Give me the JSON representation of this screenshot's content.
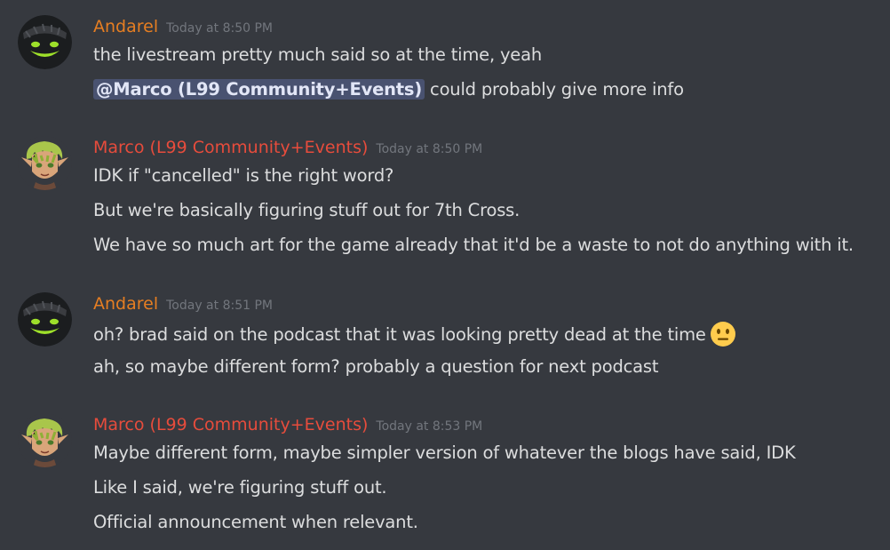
{
  "colors": {
    "andarel": "#e67e22",
    "marco": "#e74c3c",
    "background": "#36393f",
    "text": "#dcddde",
    "timestamp": "#72767d",
    "mention_bg": "#4a4f72"
  },
  "messages": [
    {
      "author": "Andarel",
      "timestamp": "Today at 8:50 PM",
      "avatar_icon": "smiling-mask-avatar-icon",
      "lines": [
        "the livestream pretty much said so at the time, yeah"
      ],
      "mention_line": {
        "mention": "@Marco (L99 Community+Events)",
        "text": " could probably give more info"
      }
    },
    {
      "author": "Marco (L99 Community+Events)",
      "timestamp": "Today at 8:50 PM",
      "avatar_icon": "elf-character-avatar-icon",
      "lines": [
        "IDK if \"cancelled\" is the right word?",
        "But we're basically figuring stuff out for 7th Cross.",
        "We have so much art for the game already that it'd be a waste to not do anything with it."
      ]
    },
    {
      "author": "Andarel",
      "timestamp": "Today at 8:51 PM",
      "avatar_icon": "smiling-mask-avatar-icon",
      "lines": [
        "oh? brad said on the podcast that it was looking pretty dead at the time",
        "ah, so maybe different form? probably a question for next podcast"
      ],
      "emoji": "neutral-face-emoji-icon"
    },
    {
      "author": "Marco (L99 Community+Events)",
      "timestamp": "Today at 8:53 PM",
      "avatar_icon": "elf-character-avatar-icon",
      "lines": [
        "Maybe different form, maybe simpler version of whatever the blogs have said, IDK",
        "Like I said, we're figuring stuff out.",
        "Official announcement when relevant."
      ]
    }
  ]
}
